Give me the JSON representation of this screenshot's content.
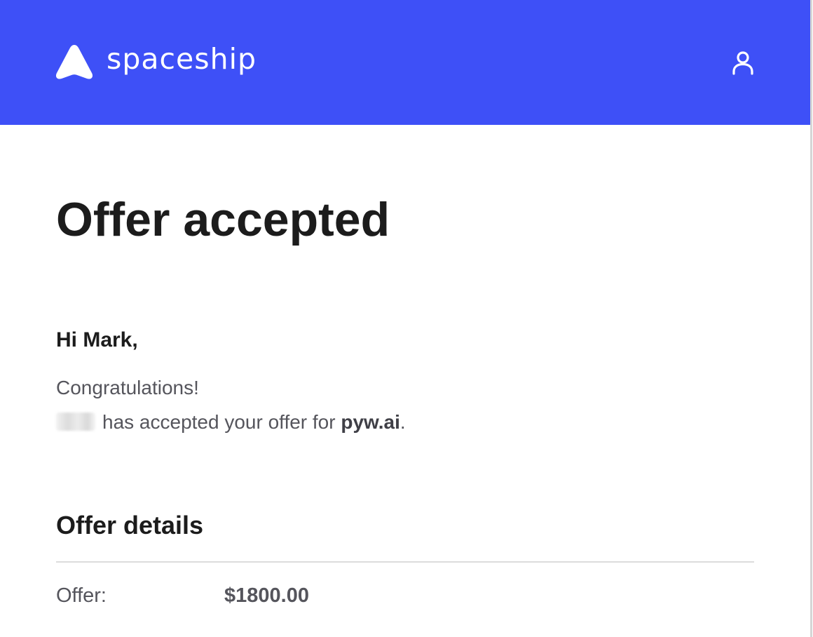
{
  "header": {
    "brand_name": "spaceship",
    "brand_color": "#3e50f7",
    "logo_icon": "spaceship-logo-icon",
    "account_icon": "user-icon"
  },
  "main": {
    "title": "Offer accepted",
    "greeting": "Hi Mark,",
    "congrats": "Congratulations!",
    "accepted_text": "has accepted your offer for",
    "domain": "pyw.ai",
    "period": "."
  },
  "offer_details": {
    "heading": "Offer details",
    "offer_label": "Offer:",
    "offer_value": "$1800.00"
  }
}
